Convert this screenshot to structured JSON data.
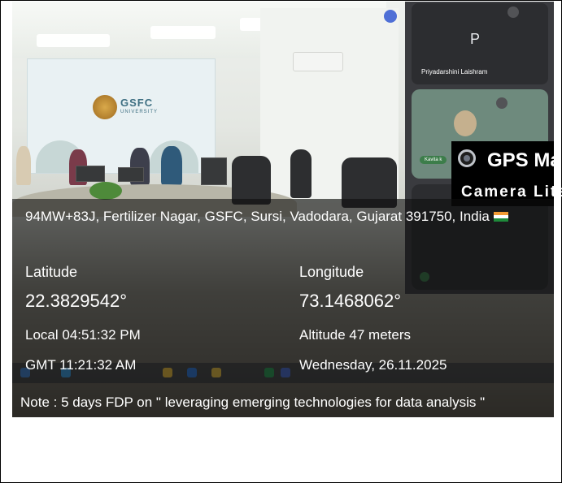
{
  "meeting": {
    "participant_initial": "P",
    "participant_name": "Priyadarshini Laishram",
    "pill_label": "Kavita k"
  },
  "scene_banner": {
    "logo_text": "GSFC",
    "logo_subtext": "UNIVERSITY"
  },
  "gps_logo": {
    "title": "GPS Ma",
    "subtitle": "Camera Lite",
    "icon": "camera-lens-icon"
  },
  "location": {
    "address": "94MW+83J, Fertilizer Nagar, GSFC, Sursi, Vadodara, Gujarat 391750, India",
    "flag_icon": "india-flag-icon",
    "latitude_label": "Latitude",
    "latitude_value": "22.3829542°",
    "longitude_label": "Longitude",
    "longitude_value": "73.1468062°",
    "local_time": "Local 04:51:32 PM",
    "gmt_time": "GMT 11:21:32 AM",
    "altitude": "Altitude 47 meters",
    "date": "Wednesday, 26.11.2025",
    "note": "Note : 5 days FDP on \" leveraging emerging technologies for data analysis \""
  },
  "colors": {
    "overlay_bg": "#0e0e0e",
    "text": "#ffffff",
    "meet_panel": "#3a3b3f"
  }
}
